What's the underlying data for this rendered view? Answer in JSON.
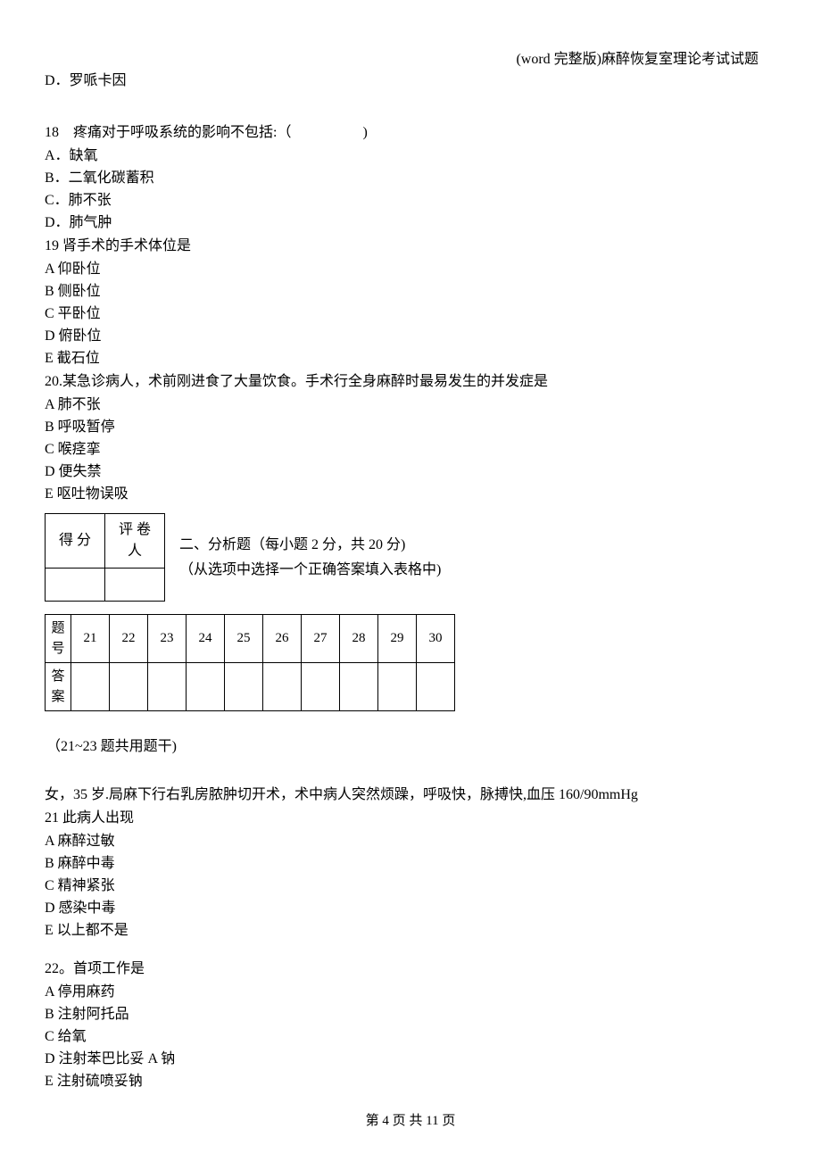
{
  "header": "(word 完整版)麻醉恢复室理论考试试题",
  "optD17": "D．罗哌卡因",
  "q18": {
    "stem": "18　疼痛对于呼吸系统的影响不包括:（　　　　　)",
    "opts": [
      "A．缺氧",
      "B．二氧化碳蓄积",
      "C．肺不张",
      "D．肺气肿"
    ]
  },
  "q19": {
    "stem": "19 肾手术的手术体位是",
    "opts": [
      "A 仰卧位",
      "B 侧卧位",
      "C 平卧位",
      "D 俯卧位",
      "E 截石位"
    ]
  },
  "q20": {
    "stem": "20.某急诊病人，术前刚进食了大量饮食。手术行全身麻醉时最易发生的并发症是",
    "opts": [
      "A 肺不张",
      "B 呼吸暂停",
      "C 喉痉挛",
      "D 便失禁",
      "E 呕吐物误吸"
    ]
  },
  "scoreTable": {
    "h1": "得 分",
    "h2": "评 卷人"
  },
  "section2": {
    "title": "二、分析题（每小题 2 分，共 20 分)",
    "subtitle": "（从选项中选择一个正确答案填入表格中)"
  },
  "answerGrid": {
    "rowLabel1": "题号",
    "rowLabel2": "答案",
    "nums": [
      "21",
      "22",
      "23",
      "24",
      "25",
      "26",
      "27",
      "28",
      "29",
      "30"
    ]
  },
  "sharedStem": "（21~23 题共用题干)",
  "caseStem": "女，35 岁.局麻下行右乳房脓肿切开术，术中病人突然烦躁，呼吸快，脉搏快,血压 160/90mmHg",
  "q21": {
    "stem": "21 此病人出现",
    "opts": [
      "A 麻醉过敏",
      "B 麻醉中毒",
      "C 精神紧张",
      "D 感染中毒",
      "E 以上都不是"
    ]
  },
  "q22": {
    "stem": "22。首项工作是",
    "opts": [
      "A 停用麻药",
      "B 注射阿托品",
      "C 给氧",
      "D 注射苯巴比妥 A 钠",
      "E 注射硫喷妥钠"
    ]
  },
  "footer": "第 4 页 共 11 页"
}
